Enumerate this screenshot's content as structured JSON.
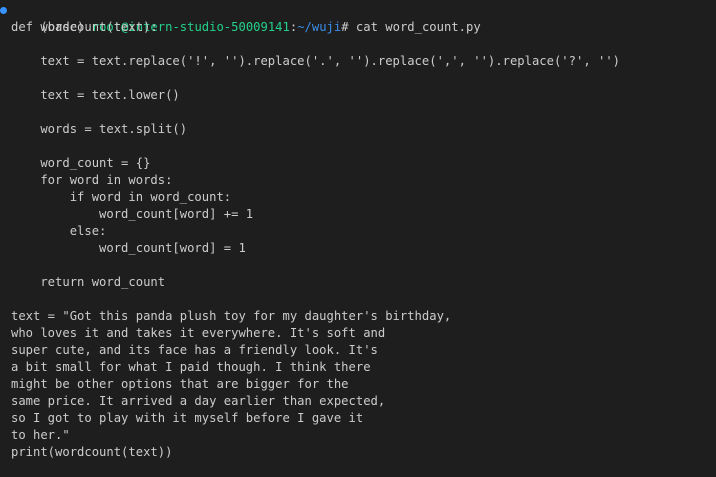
{
  "prompt": {
    "env": "(base) ",
    "user_host": "root@intern-studio-50009141",
    "sep": ":",
    "cwd": "~/wuji",
    "symbol": "# ",
    "command": "cat word_count.py"
  },
  "code_lines": [
    "def wordcount(text):",
    "",
    "    text = text.replace('!', '').replace('.', '').replace(',', '').replace('?', '')",
    "",
    "    text = text.lower()",
    "",
    "    words = text.split()",
    "",
    "    word_count = {}",
    "    for word in words:",
    "        if word in word_count:",
    "            word_count[word] += 1",
    "        else:",
    "            word_count[word] = 1",
    "",
    "    return word_count",
    "",
    "text = \"Got this panda plush toy for my daughter's birthday,",
    "who loves it and takes it everywhere. It's soft and",
    "super cute, and its face has a friendly look. It's",
    "a bit small for what I paid though. I think there",
    "might be other options that are bigger for the",
    "same price. It arrived a day earlier than expected,",
    "so I got to play with it myself before I gave it",
    "to her.\"",
    "print(wordcount(text))"
  ]
}
